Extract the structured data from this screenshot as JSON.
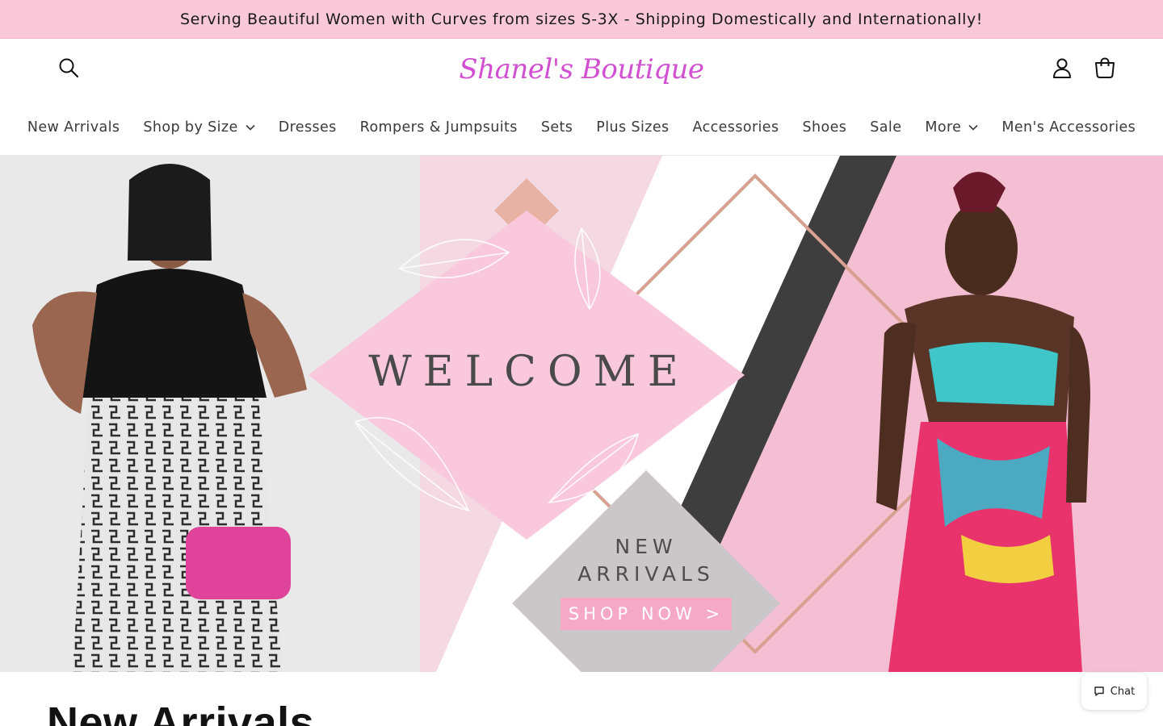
{
  "announcement": {
    "text": "Serving Beautiful Women with Curves from sizes S-3X - Shipping Domestically and Internationally!"
  },
  "header": {
    "logo_text": "Shanel's Boutique",
    "icons": {
      "search": "search-icon",
      "account": "user-icon",
      "cart": "cart-icon"
    }
  },
  "nav": {
    "items": [
      {
        "label": "New Arrivals",
        "dropdown": false
      },
      {
        "label": "Shop by Size",
        "dropdown": true
      },
      {
        "label": "Dresses",
        "dropdown": false
      },
      {
        "label": "Rompers & Jumpsuits",
        "dropdown": false
      },
      {
        "label": "Sets",
        "dropdown": false
      },
      {
        "label": "Plus Sizes",
        "dropdown": false
      },
      {
        "label": "Accessories",
        "dropdown": false
      },
      {
        "label": "Shoes",
        "dropdown": false
      },
      {
        "label": "Sale",
        "dropdown": false
      },
      {
        "label": "More",
        "dropdown": true
      },
      {
        "label": "Men's Accessories",
        "dropdown": false
      }
    ]
  },
  "hero": {
    "welcome": "WELCOME",
    "new_line": "NEW",
    "arrivals_line": "ARRIVALS",
    "cta": "SHOP NOW >"
  },
  "section": {
    "title": "New Arrivals"
  },
  "chat": {
    "label": "Chat"
  },
  "colors": {
    "announcement_bg": "#f9c8d9",
    "logo": "#d24fd2",
    "hero_pink": "#f9c8dc",
    "cta_bg": "#f6a9c6"
  }
}
